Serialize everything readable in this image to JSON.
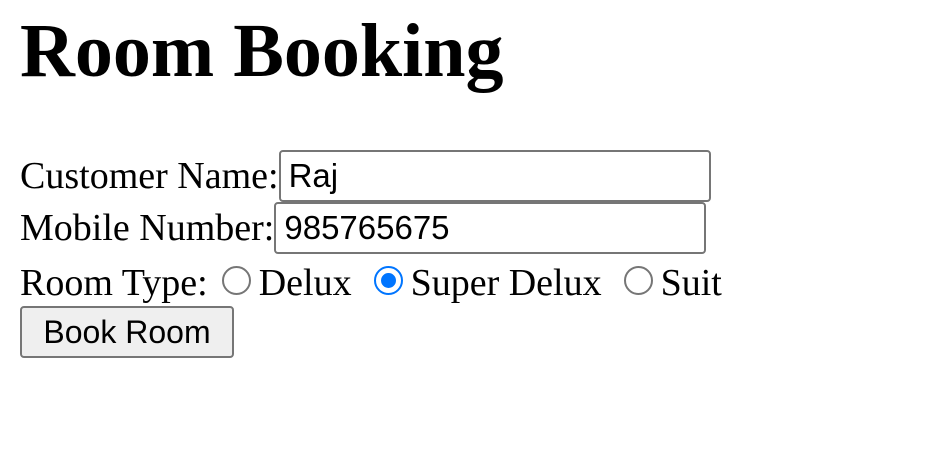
{
  "page": {
    "title": "Room Booking"
  },
  "form": {
    "customer_name_label": "Customer Name:",
    "customer_name_value": "Raj",
    "mobile_label": "Mobile Number:",
    "mobile_value": "985765675",
    "room_type_label": "Room Type:",
    "room_types": [
      {
        "label": "Delux",
        "checked": false
      },
      {
        "label": "Super Delux",
        "checked": true
      },
      {
        "label": "Suit",
        "checked": false
      }
    ],
    "submit_label": "Book Room"
  },
  "colors": {
    "radio_accent": "#0075ff",
    "control_border": "#767676",
    "button_background": "#efefef"
  }
}
